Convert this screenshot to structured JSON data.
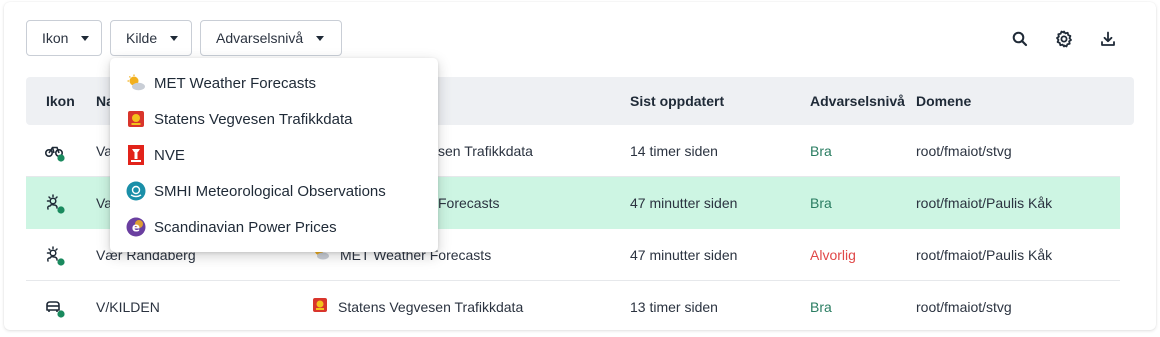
{
  "filters": {
    "icon_label": "Ikon",
    "source_label": "Kilde",
    "severity_label": "Advarselsnivå"
  },
  "toolbar": {
    "search_icon": "search-icon",
    "settings_icon": "gear-icon",
    "download_icon": "download-icon"
  },
  "table": {
    "headers": {
      "icon": "Ikon",
      "name": "Na",
      "updated": "Sist oppdatert",
      "severity": "Advarselsnivå",
      "domain": "Domene"
    },
    "rows": [
      {
        "name": "Va",
        "source": "sen Trafikkdata",
        "updated": "14 timer siden",
        "severity": "Bra",
        "domain": "root/fmaiot/stvg",
        "icon": "bicycle-icon"
      },
      {
        "name": "Va",
        "source": "Forecasts",
        "updated": "47 minutter siden",
        "severity": "Bra",
        "domain": "root/fmaiot/Paulis Kåk",
        "icon": "weather-icon"
      },
      {
        "name": "Vær Randaberg",
        "source": "MET Weather Forecasts",
        "updated": "47 minutter siden",
        "severity": "Alvorlig",
        "domain": "root/fmaiot/Paulis Kåk",
        "icon": "weather-icon"
      },
      {
        "name": "V/KILDEN",
        "source": "Statens Vegvesen Trafikkdata",
        "updated": "13 timer siden",
        "severity": "Bra",
        "domain": "root/fmaiot/stvg",
        "icon": "car-icon"
      }
    ]
  },
  "source_dropdown": {
    "items": [
      {
        "label": "MET Weather Forecasts",
        "icon": "sun-cloud-icon"
      },
      {
        "label": "Statens Vegvesen Trafikkdata",
        "icon": "vegvesen-logo-icon"
      },
      {
        "label": "NVE",
        "icon": "nve-logo-icon"
      },
      {
        "label": "SMHI Meteorological Observations",
        "icon": "smhi-logo-icon"
      },
      {
        "label": "Scandinavian Power Prices",
        "icon": "power-price-logo-icon"
      }
    ]
  },
  "colors": {
    "selected_row": "#cdf5e3",
    "status_good": "#2a7d62",
    "status_bad": "#e04848",
    "online_dot": "#1a8a5e",
    "header_bg": "#eef0f3"
  }
}
